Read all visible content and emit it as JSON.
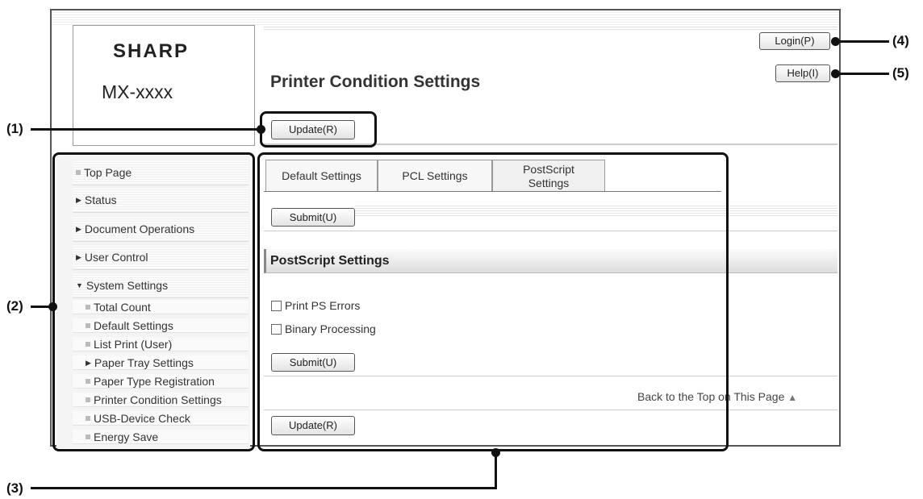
{
  "header": {
    "brand": "SHARP",
    "model": "MX-xxxx",
    "page_title": "Printer Condition Settings",
    "login_label": "Login(P)",
    "help_label": "Help(I)",
    "update_label": "Update(R)"
  },
  "sidebar": {
    "items": [
      {
        "label": "Top Page",
        "marker": "square"
      },
      {
        "label": "Status",
        "marker": "triangle-right"
      },
      {
        "label": "Document Operations",
        "marker": "triangle-right"
      },
      {
        "label": "User Control",
        "marker": "triangle-right"
      },
      {
        "label": "System Settings",
        "marker": "triangle-down"
      }
    ],
    "subitems": [
      {
        "label": "Total Count",
        "marker": "square"
      },
      {
        "label": "Default Settings",
        "marker": "square"
      },
      {
        "label": "List Print (User)",
        "marker": "square"
      },
      {
        "label": "Paper Tray Settings",
        "marker": "triangle-right"
      },
      {
        "label": "Paper Type Registration",
        "marker": "square"
      },
      {
        "label": "Printer Condition Settings",
        "marker": "square"
      },
      {
        "label": "USB-Device Check",
        "marker": "square"
      },
      {
        "label": "Energy Save",
        "marker": "square"
      }
    ]
  },
  "tabs": [
    {
      "label": "Default Settings"
    },
    {
      "label": "PCL Settings"
    },
    {
      "label": "PostScript Settings",
      "active": true
    }
  ],
  "main": {
    "submit_label": "Submit(U)",
    "section_title": "PostScript Settings",
    "options": [
      {
        "label": "Print PS Errors",
        "checked": false
      },
      {
        "label": "Binary Processing",
        "checked": false
      }
    ],
    "back_to_top": "Back to the Top on This Page",
    "update_label": "Update(R)"
  },
  "callouts": {
    "c1": "(1)",
    "c2": "(2)",
    "c3": "(3)",
    "c4": "(4)",
    "c5": "(5)"
  }
}
